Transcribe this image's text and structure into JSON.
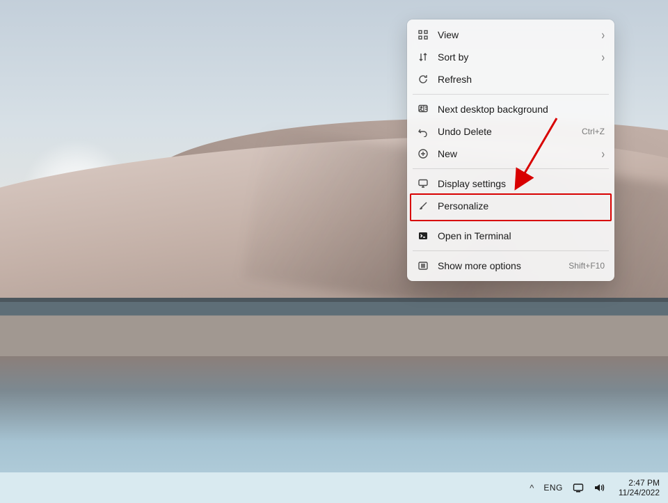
{
  "context_menu": {
    "items": [
      {
        "icon": "grid-icon",
        "label": "View",
        "hint": "",
        "submenu": true
      },
      {
        "icon": "sort-icon",
        "label": "Sort by",
        "hint": "",
        "submenu": true
      },
      {
        "icon": "refresh-icon",
        "label": "Refresh",
        "hint": "",
        "submenu": false
      },
      {
        "sep": true
      },
      {
        "icon": "image-icon",
        "label": "Next desktop background",
        "hint": "",
        "submenu": false
      },
      {
        "icon": "undo-icon",
        "label": "Undo Delete",
        "hint": "Ctrl+Z",
        "submenu": false
      },
      {
        "icon": "plus-icon",
        "label": "New",
        "hint": "",
        "submenu": true
      },
      {
        "sep": true
      },
      {
        "icon": "display-icon",
        "label": "Display settings",
        "hint": "",
        "submenu": false
      },
      {
        "icon": "brush-icon",
        "label": "Personalize",
        "hint": "",
        "submenu": false,
        "highlighted": true
      },
      {
        "sep": true
      },
      {
        "icon": "terminal-icon",
        "label": "Open in Terminal",
        "hint": "",
        "submenu": false
      },
      {
        "sep": true
      },
      {
        "icon": "more-icon",
        "label": "Show more options",
        "hint": "Shift+F10",
        "submenu": false
      }
    ]
  },
  "taskbar": {
    "language": "ENG",
    "time": "2:47 PM",
    "date": "11/24/2022"
  },
  "annotation": {
    "color": "#d80000"
  }
}
